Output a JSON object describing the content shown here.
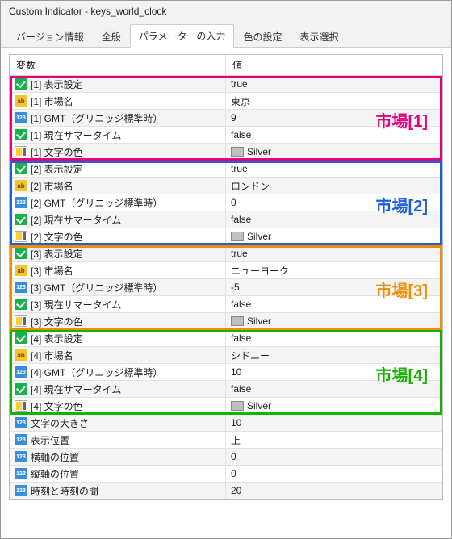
{
  "window": {
    "title": "Custom Indicator - keys_world_clock"
  },
  "tabs": {
    "version": "バージョン情報",
    "general": "全般",
    "params": "パラメーターの入力",
    "colors": "色の設定",
    "display": "表示選択"
  },
  "headers": {
    "variable": "変数",
    "value": "値"
  },
  "groups": [
    {
      "label": "市場[1]",
      "color": "#e6007e",
      "rows": [
        {
          "icon": "bool",
          "name": "[1] 表示設定",
          "value": "true"
        },
        {
          "icon": "str",
          "name": "[1] 市場名",
          "value": "東京"
        },
        {
          "icon": "int",
          "name": "[1] GMT（グリニッジ標準時）",
          "value": "9"
        },
        {
          "icon": "bool",
          "name": "[1] 現在サマータイム",
          "value": "false"
        },
        {
          "icon": "color",
          "name": "[1] 文字の色",
          "value": "Silver",
          "swatch": "#c0c0c0"
        }
      ]
    },
    {
      "label": "市場[2]",
      "color": "#1b5fd9",
      "rows": [
        {
          "icon": "bool",
          "name": "[2] 表示設定",
          "value": "true"
        },
        {
          "icon": "str",
          "name": "[2] 市場名",
          "value": "ロンドン"
        },
        {
          "icon": "int",
          "name": "[2] GMT（グリニッジ標準時）",
          "value": "0"
        },
        {
          "icon": "bool",
          "name": "[2] 現在サマータイム",
          "value": "false"
        },
        {
          "icon": "color",
          "name": "[2] 文字の色",
          "value": "Silver",
          "swatch": "#c0c0c0"
        }
      ]
    },
    {
      "label": "市場[3]",
      "color": "#f28c00",
      "rows": [
        {
          "icon": "bool",
          "name": "[3] 表示設定",
          "value": "true"
        },
        {
          "icon": "str",
          "name": "[3] 市場名",
          "value": "ニューヨーク"
        },
        {
          "icon": "int",
          "name": "[3] GMT（グリニッジ標準時）",
          "value": "-5"
        },
        {
          "icon": "bool",
          "name": "[3] 現在サマータイム",
          "value": "false"
        },
        {
          "icon": "color",
          "name": "[3] 文字の色",
          "value": "Silver",
          "swatch": "#c0c0c0"
        }
      ]
    },
    {
      "label": "市場[4]",
      "color": "#14b300",
      "rows": [
        {
          "icon": "bool",
          "name": "[4] 表示設定",
          "value": "false"
        },
        {
          "icon": "str",
          "name": "[4] 市場名",
          "value": "シドニー"
        },
        {
          "icon": "int",
          "name": "[4] GMT（グリニッジ標準時）",
          "value": "10"
        },
        {
          "icon": "bool",
          "name": "[4] 現在サマータイム",
          "value": "false"
        },
        {
          "icon": "color",
          "name": "[4] 文字の色",
          "value": "Silver",
          "swatch": "#c0c0c0"
        }
      ]
    }
  ],
  "extra_rows": [
    {
      "icon": "int",
      "name": "文字の大きさ",
      "value": "10"
    },
    {
      "icon": "int",
      "name": "表示位置",
      "value": "上"
    },
    {
      "icon": "int",
      "name": "横軸の位置",
      "value": "0"
    },
    {
      "icon": "int",
      "name": "縦軸の位置",
      "value": "0"
    },
    {
      "icon": "int",
      "name": "時刻と時刻の間",
      "value": "20"
    }
  ]
}
